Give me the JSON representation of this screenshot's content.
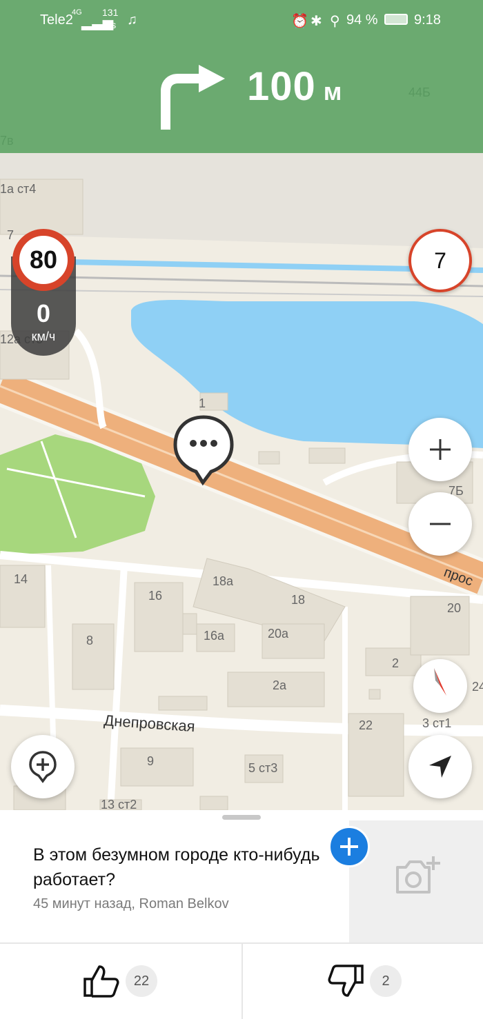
{
  "status_bar": {
    "carrier": "Tele2",
    "network": "4G",
    "net_speed_value": "131",
    "net_speed_unit": "K/s",
    "battery": "94 %",
    "time": "9:18"
  },
  "navigation": {
    "maneuver_icon": "turn-right-arrow-icon",
    "distance_value": "100",
    "distance_unit": "м"
  },
  "speed": {
    "limit": "80",
    "current": "0",
    "unit": "км/ч"
  },
  "speed_camera_count": "7",
  "map": {
    "street_label": "Днепровская",
    "street_label_2": "прос",
    "building_labels": [
      "1",
      "14",
      "16",
      "18а",
      "18",
      "16а",
      "20а",
      "8",
      "20",
      "2",
      "2а",
      "22",
      "3 ст1",
      "9",
      "5 ст3",
      "13 ст2",
      "7Б",
      "44Б",
      "7в",
      "1а ст4",
      "7",
      "12а ст5",
      "24"
    ]
  },
  "controls": {
    "zoom_in_icon": "plus-icon",
    "zoom_out_icon": "minus-icon",
    "compass_icon": "compass-icon",
    "locate_icon": "navigation-arrow-icon",
    "add_point_icon": "add-marker-icon"
  },
  "post": {
    "title": "В этом безумном городе кто-нибудь работает?",
    "meta": "45 минут назад, Roman Belkov",
    "likes": "22",
    "dislikes": "2"
  },
  "colors": {
    "banner": "#58a060",
    "accent": "#1b7ee0",
    "speed_limit_red": "#d7442a",
    "water": "#8fd0f5",
    "park": "#a7d77d",
    "road": "#eeb07c"
  }
}
